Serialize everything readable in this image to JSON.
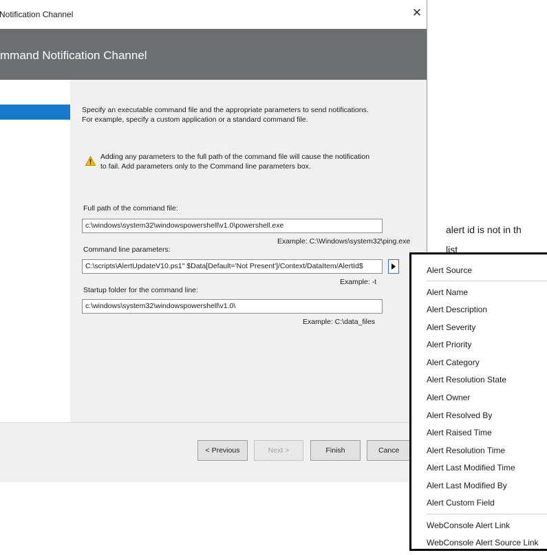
{
  "dialog": {
    "title": "Notification Channel",
    "header": "mmand Notification Channel"
  },
  "content": {
    "intro_line1": "Specify an executable command file and the appropriate parameters to send notifications.",
    "intro_line2": "For example, specify a custom application or a standard command file.",
    "warning_line1": "Adding any parameters to the full path of the command file will cause the notification",
    "warning_line2": "to fail. Add parameters only to the Command line parameters box.",
    "path_label": "Full path of the command file:",
    "path_value": "c:\\windows\\system32\\windowspowershell\\v1.0\\powershell.exe",
    "path_example": "Example: C:\\Windows\\system32\\ping.exe",
    "params_label": "Command line parameters:",
    "params_value": "C:\\scripts\\AlertUpdateV10.ps1\"  $Data[Default='Not Present']/Context/DataItem/AlertId$",
    "params_example": "Example: -t",
    "startup_label": "Startup folder for the command line:",
    "startup_value": "c:\\windows\\system32\\windowspowershell\\v1.0\\",
    "startup_example": "Example: C:\\data_files"
  },
  "footer": {
    "previous": "< Previous",
    "next": "Next >",
    "finish": "Finish",
    "cancel": "Cance"
  },
  "note": {
    "line1": "alert id is not in th",
    "line2": "list"
  },
  "menu": {
    "items": [
      "Alert Source",
      "Alert Name",
      "Alert Description",
      "Alert Severity",
      "Alert Priority",
      "Alert Category",
      "Alert Resolution State",
      "Alert Owner",
      "Alert Resolved By",
      "Alert Raised Time",
      "Alert Resolution Time",
      "Alert Last Modified Time",
      "Alert Last Modified By",
      "Alert Custom Field",
      "WebConsole Alert Link",
      "WebConsole Alert Source Link"
    ]
  },
  "colors": {
    "header_band": "#6d6e70",
    "selection": "#1679cc",
    "panel": "#f0f0f0",
    "warning": "#f5c400"
  },
  "icons": {
    "close": "close-icon",
    "warning": "warning-icon",
    "insert": "triangle-right-icon"
  }
}
